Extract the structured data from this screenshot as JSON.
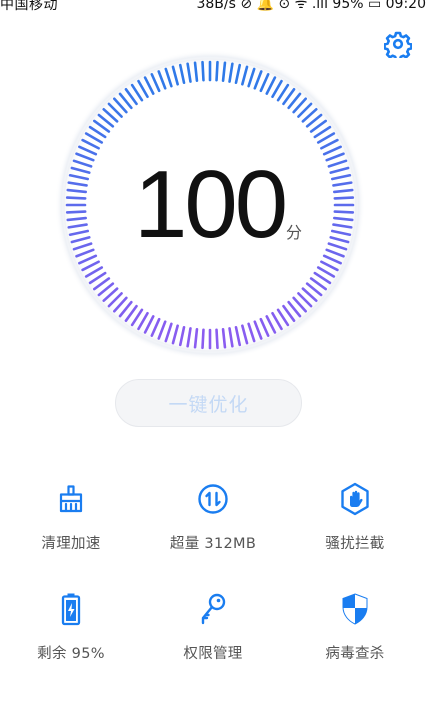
{
  "status_bar": {
    "carrier": "中国移动",
    "right_text": "38B/s ⊘ 🔔 ⊙ ᯤ .ıll 95% ▭ 09:20"
  },
  "header": {
    "settings_icon": "gear-icon"
  },
  "score": {
    "value": "100",
    "unit": "分"
  },
  "optimize_button": {
    "label": "一键优化"
  },
  "tools": [
    {
      "icon": "broom-icon",
      "label": "清理加速"
    },
    {
      "icon": "data-traffic-icon",
      "label": "超量 312MB"
    },
    {
      "icon": "hand-block-icon",
      "label": "骚扰拦截"
    },
    {
      "icon": "battery-icon",
      "label": "剩余 95%"
    },
    {
      "icon": "key-icon",
      "label": "权限管理"
    },
    {
      "icon": "shield-icon",
      "label": "病毒查杀"
    }
  ],
  "colors": {
    "accent": "#1a7df0",
    "gauge_start": "#2f7ae8",
    "gauge_end": "#8a5cf0"
  }
}
